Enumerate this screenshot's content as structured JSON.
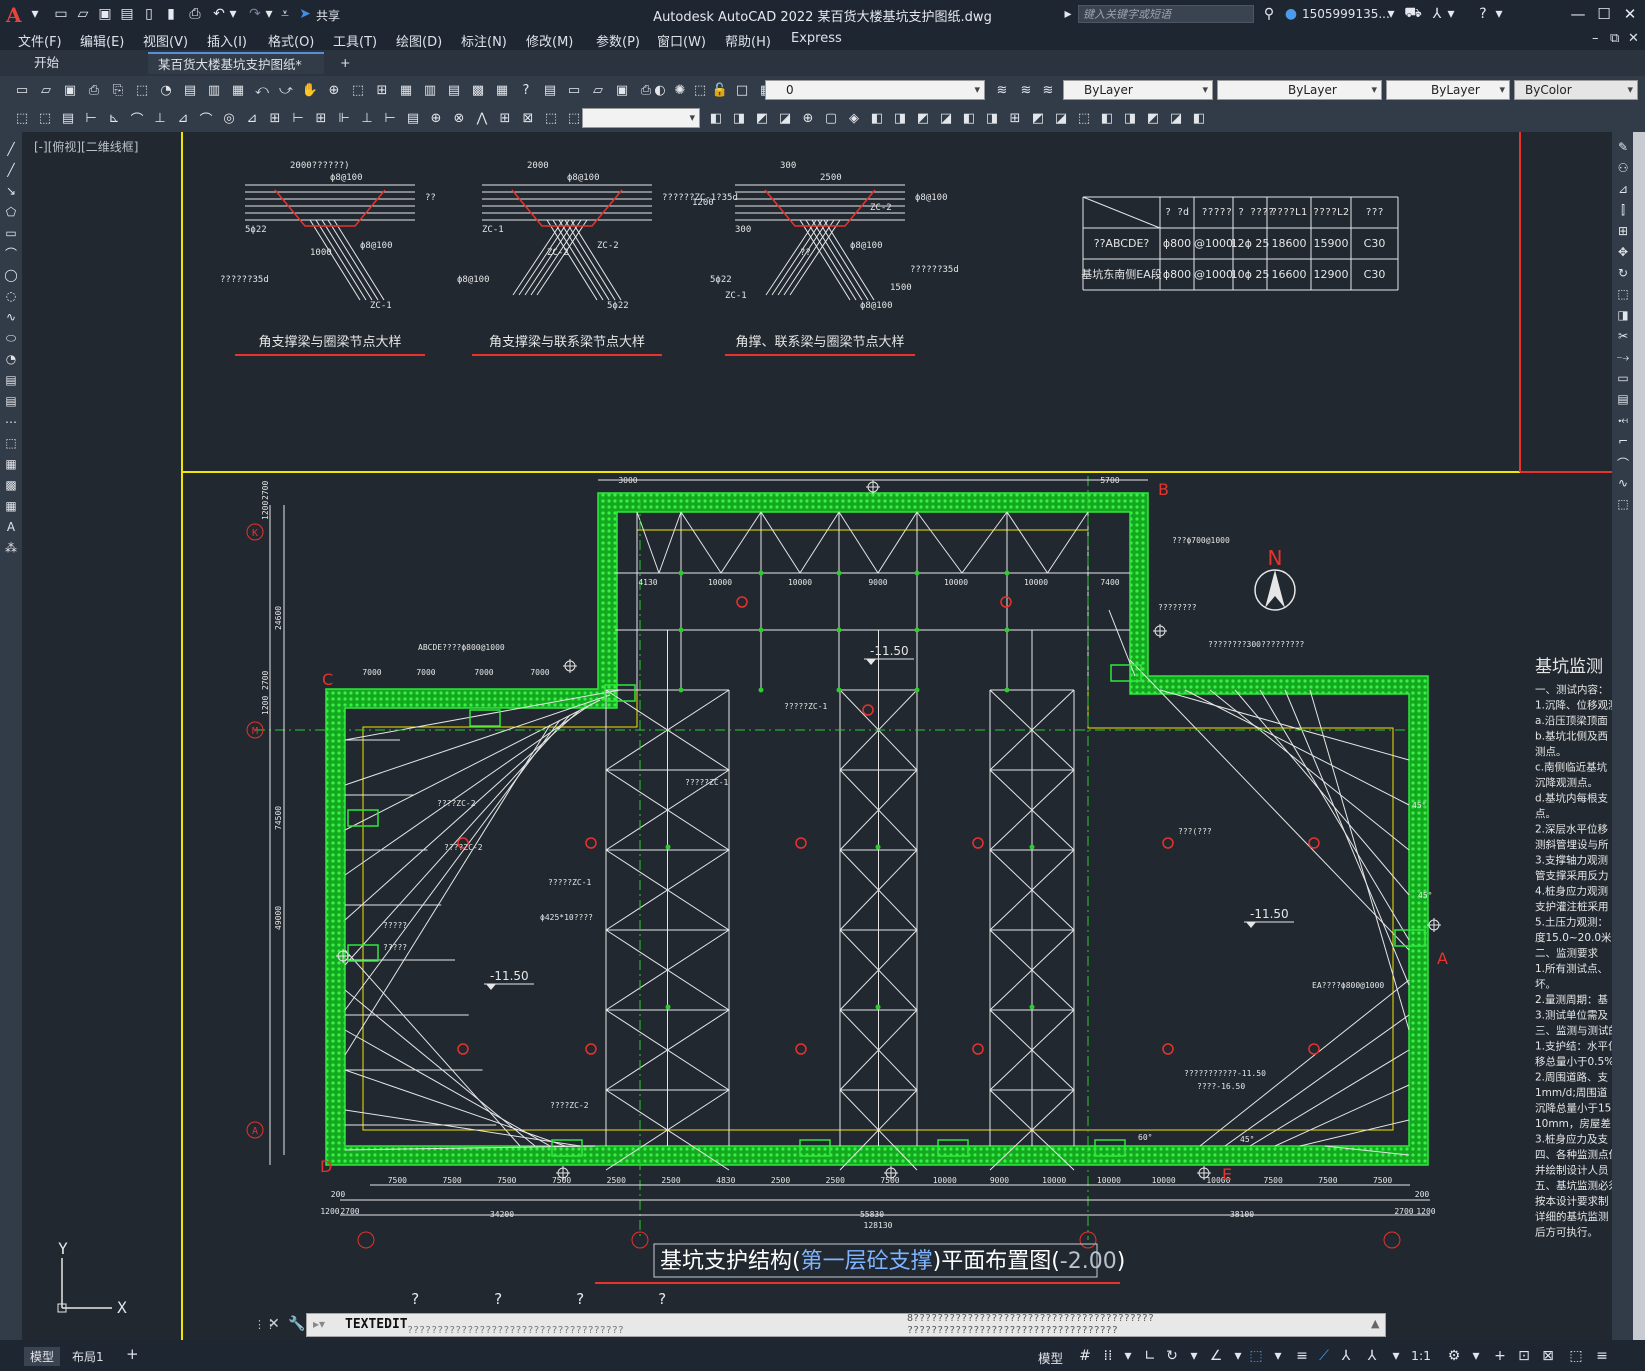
{
  "app": {
    "title": "Autodesk AutoCAD 2022    某百货大楼基坑支护图纸.dwg",
    "logo": "A",
    "share_label": "共享",
    "search_placeholder": "键入关键字或短语",
    "user": "1505999135...",
    "accent_color": "#e8443b"
  },
  "menu": [
    "文件(F)",
    "编辑(E)",
    "视图(V)",
    "插入(I)",
    "格式(O)",
    "工具(T)",
    "绘图(D)",
    "标注(N)",
    "修改(M)",
    "参数(P)",
    "窗口(W)",
    "帮助(H)",
    "Express"
  ],
  "tabs": {
    "start": "开始",
    "active": "某百货大楼基坑支护图纸*",
    "add": "+"
  },
  "properties": {
    "layer_value": "0",
    "color": "ByLayer",
    "linetype": "ByLayer",
    "lineweight": "ByLayer",
    "plotstyle": "ByColor"
  },
  "viewport_label": "[-][俯视][二维线框]",
  "drawing": {
    "details": [
      {
        "title": "角支撑梁与圈梁节点大样",
        "dims": [
          "2000??????)",
          "ϕ8@100",
          "5ϕ22",
          "??????35d",
          "ZC-1",
          "ϕ8@100",
          "1000",
          "??"
        ]
      },
      {
        "title": "角支撑梁与联系梁节点大样",
        "dims": [
          "2000",
          "ϕ8@100",
          "ZC-1",
          "ϕ8@100",
          "5ϕ22",
          "ZC-2",
          "ZC-2",
          "??????ZC-1?35d"
        ]
      },
      {
        "title": "角撑、联系梁与圈梁节点大样",
        "dims": [
          "300",
          "2500",
          "300",
          "5ϕ22",
          "ϕ8@100",
          "ϕ8@100",
          "??",
          "ϕ8@100",
          "ZC-2",
          "??????35d",
          "ZC-1",
          "1500",
          "1200"
        ]
      }
    ],
    "table": {
      "header": [
        "",
        "? ?d",
        "????",
        "? ?\n????",
        "????L1",
        "????L2",
        "???"
      ],
      "rows": [
        [
          "??ABCDE?",
          "ϕ800",
          "@1000",
          "12ϕ 25",
          "18600",
          "15900",
          "C30"
        ],
        [
          "基坑东南侧EA段",
          "ϕ800",
          "@1000",
          "10ϕ 25",
          "16600",
          "12900",
          "C30"
        ]
      ]
    },
    "plan_title": "基坑支护结构(第一层砼支撑)平面布置图(-2.00)",
    "plan_title_parts": [
      "基坑支护结构(",
      "第一层砼支撑",
      ")平面布置图(",
      "-2.00",
      ")"
    ],
    "north": "N",
    "corner_labels": [
      "B",
      "C",
      "D",
      "E",
      "A"
    ],
    "axis_labels": [
      "K",
      "M",
      "A"
    ],
    "elevations": [
      "-11.50",
      "-11.50",
      "-11.50"
    ],
    "annotations": [
      "ABCDE????ϕ800@1000",
      "???ϕ700@1000",
      "????????",
      "????????300?????????",
      "?????ZC-1",
      "?????ZC-1",
      "????ZC-2",
      "?????ZC-1",
      "ϕ425*10????",
      "?????",
      "?????",
      "????ZC-2",
      "????ZC-2",
      "???(???",
      "EA????ϕ800@1000",
      "???????????-11.50",
      "????-16.50",
      "60°",
      "45°",
      "45°",
      "45°"
    ],
    "top_dims": [
      "3000",
      "5700",
      "4130",
      "10000",
      "10000",
      "9000",
      "10000",
      "10000",
      "7400"
    ],
    "bottom_dims": [
      "7500",
      "7500",
      "7500",
      "7500",
      "2500",
      "2500",
      "4830",
      "2500",
      "2500",
      "7500",
      "10000",
      "9000",
      "10000",
      "10000",
      "10000",
      "10000",
      "7500",
      "7500",
      "7500"
    ],
    "bottom_totals": [
      "34200",
      "55830",
      "38100",
      "128130",
      "200",
      "200",
      "1200",
      "2700",
      "2700",
      "1200"
    ],
    "left_dims": [
      "24600",
      "74500",
      "49000",
      "2700",
      "1200",
      "2700",
      "1200"
    ],
    "left_top_dims": [
      "7000",
      "7000",
      "7000",
      "7000"
    ],
    "right_panel": {
      "title": "基坑监测",
      "lines": [
        "一、测试内容：",
        "1.沉降、位移观测",
        "a.沿压顶梁顶面",
        "b.基坑北侧及西",
        "测点。",
        "c.南侧临近基坑",
        "沉降观测点。",
        "d.基坑内每根支",
        "点。",
        "2.深层水平位移",
        "测斜管埋设与所",
        "3.支撑轴力观测",
        "管支撑采用反力",
        "4.桩身应力观测",
        "支护灌注桩采用",
        "5.土压力观测：",
        "度15.0~20.0米",
        "二、监测要求",
        "1.所有测试点、",
        "坏。",
        "2.量测周期：基",
        "3.测试单位需及",
        "三、监测与测试的",
        "1.支护结：水平位",
        "移总量小于0.5%",
        "2.周围道路、支",
        "1mm/d;周围道",
        "沉降总量小于15",
        "10mm，房屋差",
        "3.桩身应力及支",
        "四、各种监测点位",
        "并绘制设计人员",
        "五、基坑监测必须",
        "按本设计要求制",
        "详细的基坑监测",
        "后方可执行。"
      ]
    },
    "ucs": {
      "x": "X",
      "y": "Y"
    },
    "question_marks": [
      "?",
      "?",
      "?",
      "?"
    ]
  },
  "command": {
    "text": "TEXTEDIT",
    "history1": "8????????????????????????????????????????",
    "history2": "???????????????????????????????????",
    "history3": "????????????????????????????????????"
  },
  "status": {
    "tabs": [
      "模型",
      "布局1"
    ],
    "model_button": "模型",
    "scale": "1:1"
  },
  "colors": {
    "frame": "#f2e600",
    "wall": "#19d12a",
    "struts": "#e6e6e6",
    "red": "#e8322c",
    "axis": "#2ccd2c"
  }
}
